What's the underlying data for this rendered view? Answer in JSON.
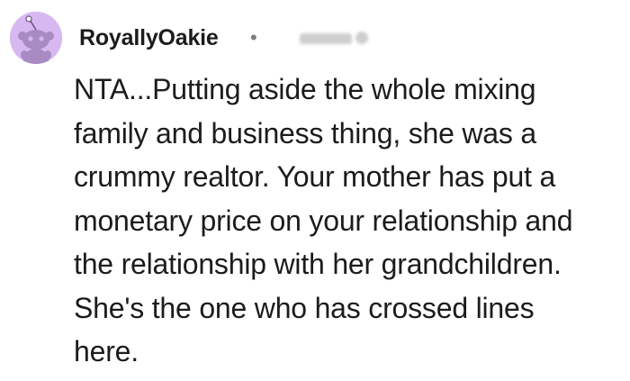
{
  "comment": {
    "author": "RoyallyOakie",
    "separator": "•",
    "avatar_icon": "reddit-snoo-icon",
    "avatar_color": "#d7b8f0",
    "body_lines": [
      "NTA...Putting aside the whole mixing",
      "family and business thing, she was a",
      "crummy realtor. Your mother has put a",
      "monetary price on your relationship and",
      "the relationship with her grandchildren.",
      "She's the one who has crossed lines",
      "here."
    ]
  }
}
